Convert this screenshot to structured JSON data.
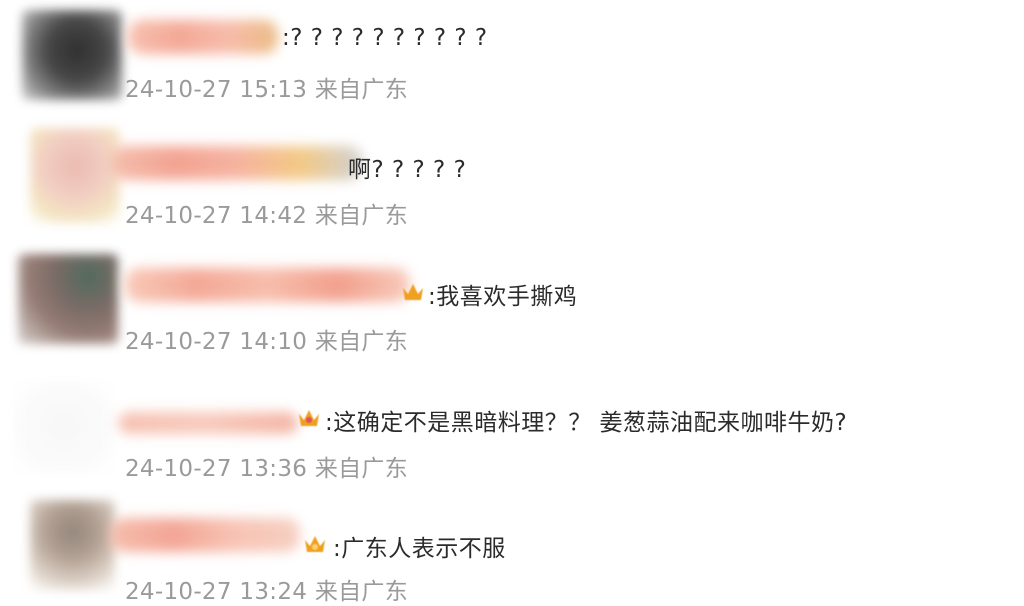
{
  "comments": [
    {
      "text": ":? ? ? ? ? ? ? ? ? ?",
      "time": "24-10-27 15:13",
      "location": "来自广东"
    },
    {
      "text": "啊? ? ? ? ?",
      "time": "24-10-27 14:42",
      "location": "来自广东"
    },
    {
      "text": ":我喜欢手撕鸡",
      "time": "24-10-27 14:10",
      "location": "来自广东"
    },
    {
      "text": ":这确定不是黑暗料理？？  姜葱蒜油配来咖啡牛奶?",
      "time": "24-10-27 13:36",
      "location": "来自广东"
    },
    {
      "text": ":广东人表示不服",
      "time": "24-10-27 13:24",
      "location": "来自广东"
    }
  ],
  "colors": {
    "text": "#2b2b2b",
    "meta": "#9a9a9a",
    "redacted_name": "#f2a48e",
    "badge": "#f0a020"
  },
  "icons": [
    "avatar",
    "vip-crown-badge-icon"
  ]
}
